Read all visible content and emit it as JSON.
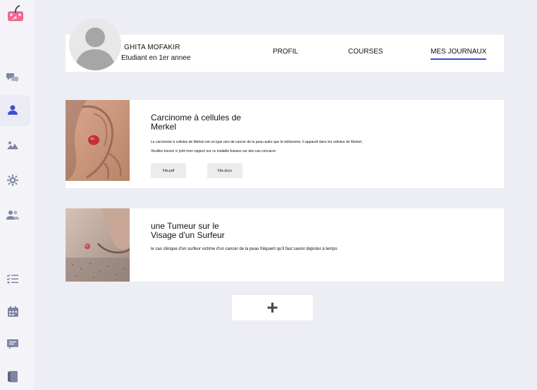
{
  "profile": {
    "name": "GHITA MOFAKIR",
    "role": "Etudiant en 1er annee"
  },
  "nav": {
    "profil": "PROFIL",
    "courses": "COURSES",
    "journaux": "MES JOURNAUX"
  },
  "journals": [
    {
      "title_line1": "Carcinome à cellules de",
      "title_line2": "Merkel",
      "text_line1": "Le carcinome à cellules de Merkel est un type rare de cancer de la peau autre que le mélanome. Il apparaît dans les cellules de Merkel,",
      "text_line2": "Veuillez touvez ci joint mon rapport sur ce maladie basees sur des cas concacre",
      "files": [
        "File.pdf",
        "File.docs"
      ]
    },
    {
      "title_line1": "une Tumeur sur le",
      "title_line2": "Visage d'un Surfeur",
      "text_line1": "le cas clinique d'un surfeur victime d'un cancer de la peau fréquent qu'il faut savoir dépister à temps"
    }
  ],
  "add_button": "+",
  "colors": {
    "accent": "#3d4fd1",
    "sidebar_icon": "#7e86a3",
    "background": "#ededf5"
  },
  "sidebar_icons": [
    "logo-icon",
    "chat-icon",
    "user-icon",
    "image-icon",
    "settings-icon",
    "group-icon",
    "checklist-icon",
    "calendar-icon",
    "message-icon",
    "book-icon"
  ]
}
